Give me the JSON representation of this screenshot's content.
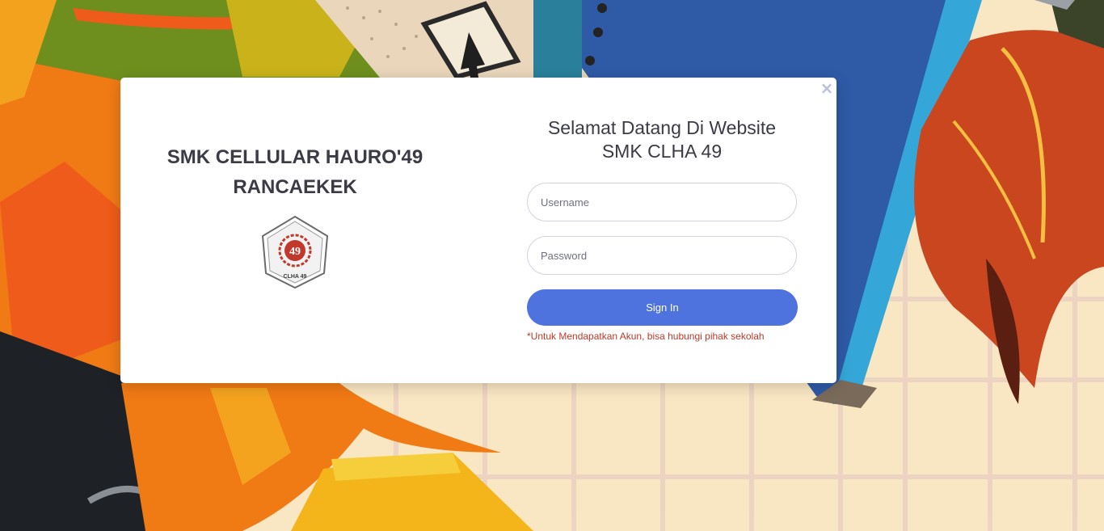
{
  "colors": {
    "primary": "#4e73df",
    "note_text": "#c0392b",
    "heading_text": "#3a3b45",
    "close_icon": "#b9c0e2"
  },
  "modal": {
    "close_icon": "close-icon",
    "school": {
      "name_line1": "SMK CELLULAR HAURO'49",
      "name_line2": "RANCAEKEK",
      "logo_number": "49",
      "logo_ring_text": "YAYASAN PENDIDIKAN KETERAMPILAN DAN KEWIRAUSAHAAN",
      "logo_bottom_text": "CLHA 49"
    },
    "welcome": {
      "line1": "Selamat Datang Di Website",
      "line2": "SMK CLHA 49"
    },
    "form": {
      "username_placeholder": "Username",
      "password_placeholder": "Password",
      "signin_label": "Sign In",
      "note": "*Untuk Mendapatkan Akun, bisa hubungi pihak sekolah"
    }
  }
}
